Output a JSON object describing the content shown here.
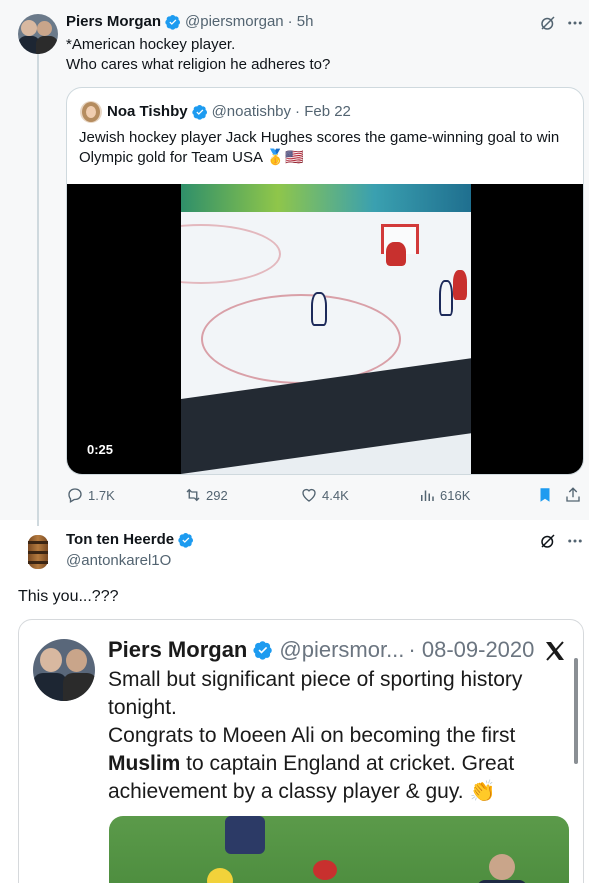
{
  "tweet": {
    "author_name": "Piers Morgan",
    "author_handle": "@piersmorgan",
    "time": "· 5h",
    "text_line1": "*American hockey player.",
    "text_line2": "Who cares what religion he adheres to?",
    "quoted": {
      "author_name": "Noa Tishby",
      "author_handle": "@noatishby",
      "time": "· Feb 22",
      "text_line1": "Jewish hockey player Jack Hughes scores the game-winning goal to win",
      "text_line2": "Olympic gold for Team USA 🥇🇺🇸",
      "video_duration": "0:25"
    },
    "stats": {
      "replies": "1.7K",
      "reposts": "292",
      "likes": "4.4K",
      "views": "616K"
    }
  },
  "reply": {
    "author_name": "Ton ten Heerde",
    "author_handle": "@antonkarel1O",
    "text": "This you...???",
    "embedded": {
      "author_name": "Piers Morgan",
      "author_handle": "@piersmor...",
      "date": "· 08-09-2020",
      "line1": "Small but significant piece of sporting history",
      "line2": "tonight.",
      "line3": "Congrats to Moeen Ali on becoming the first",
      "line4_bold": "Muslim",
      "line4_rest": " to captain England at cricket. Great",
      "line5": "achievement by a classy player & guy. 👏"
    }
  },
  "colors": {
    "verified_blue": "#1d9bf0",
    "secondary_text": "#536471",
    "bookmark_active": "#1d9bf0"
  }
}
